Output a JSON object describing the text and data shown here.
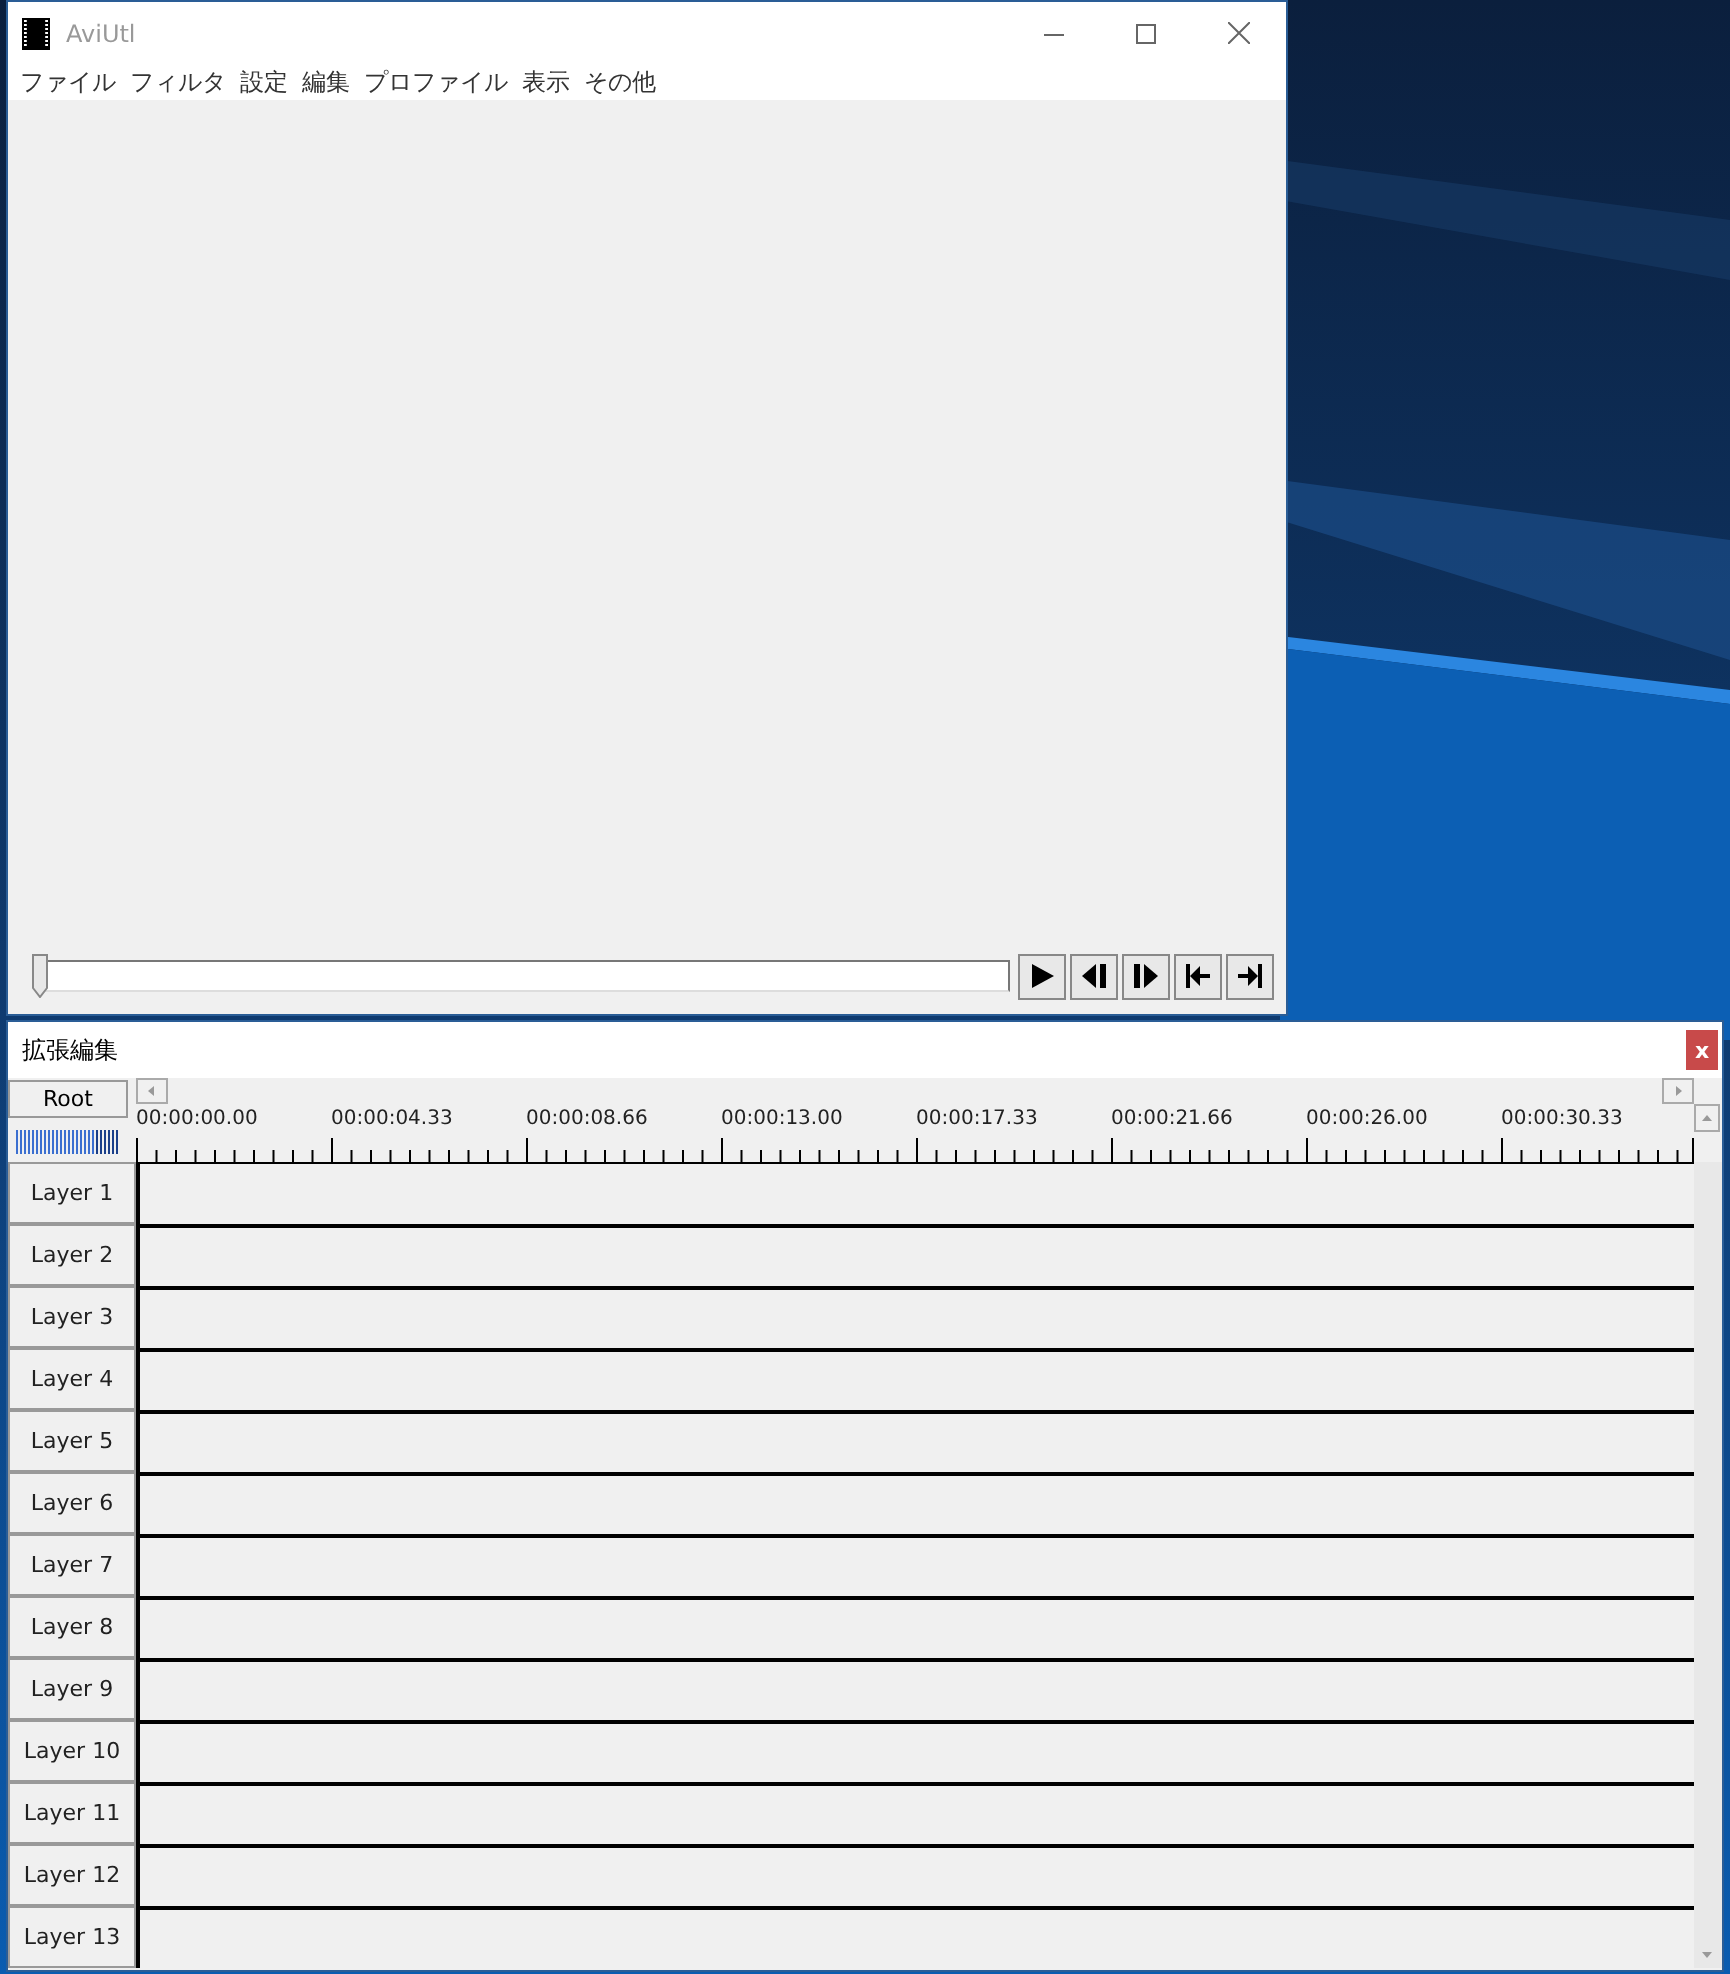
{
  "main_window": {
    "title": "AviUtl",
    "menu": [
      "ファイル",
      "フィルタ",
      "設定",
      "編集",
      "プロファイル",
      "表示",
      "その他"
    ],
    "seekbar": {
      "level": 0
    }
  },
  "timeline_window": {
    "title": "拡張編集",
    "close": "x",
    "root": "Root",
    "time_labels": [
      "00:00:00.00",
      "00:00:04.33",
      "00:00:08.66",
      "00:00:13.00",
      "00:00:17.33",
      "00:00:21.66",
      "00:00:26.00",
      "00:00:30.33"
    ],
    "layers": [
      "Layer 1",
      "Layer 2",
      "Layer 3",
      "Layer 4",
      "Layer 5",
      "Layer 6",
      "Layer 7",
      "Layer 8",
      "Layer 9",
      "Layer 10",
      "Layer 11",
      "Layer 12",
      "Layer 13"
    ]
  }
}
